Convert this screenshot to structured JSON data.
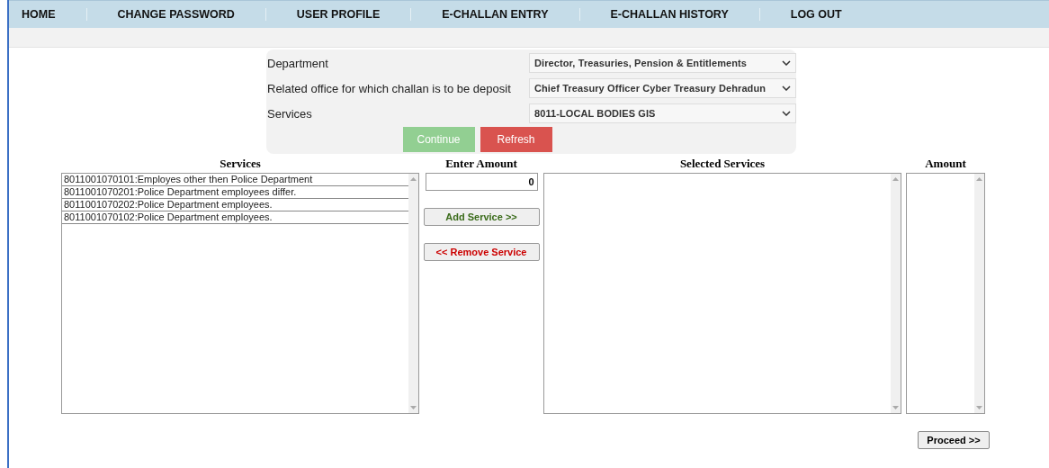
{
  "nav": [
    {
      "label": "HOME"
    },
    {
      "label": "CHANGE PASSWORD"
    },
    {
      "label": "USER PROFILE"
    },
    {
      "label": "E-CHALLAN ENTRY"
    },
    {
      "label": "E-CHALLAN HISTORY"
    },
    {
      "label": "LOG OUT"
    }
  ],
  "form": {
    "fields": [
      {
        "label": "Department",
        "value": "Director, Treasuries, Pension & Entitlements"
      },
      {
        "label": "Related office for which challan is to be deposit",
        "value": "Chief Treasury Officer Cyber Treasury Dehradun"
      },
      {
        "label": "Services",
        "value": "8011-LOCAL BODIES GIS"
      }
    ],
    "buttons": [
      {
        "label": "Continue",
        "kind": "continue",
        "disabled": true
      },
      {
        "label": "Refresh",
        "kind": "refresh",
        "disabled": false
      }
    ]
  },
  "services": {
    "heading": "Services",
    "items": [
      "8011001070101:Employes other then Police Department",
      "8011001070201:Police Department employees differ.",
      "8011001070202:Police Department employees.",
      "8011001070102:Police Department employees."
    ]
  },
  "amount_entry": {
    "heading": "Enter Amount",
    "value": "0",
    "add_button": "Add Service >>",
    "remove_button": "<< Remove Service"
  },
  "selected_services": {
    "heading": "Selected Services"
  },
  "amounts": {
    "heading": "Amount"
  },
  "proceed_button": "Proceed >>"
}
